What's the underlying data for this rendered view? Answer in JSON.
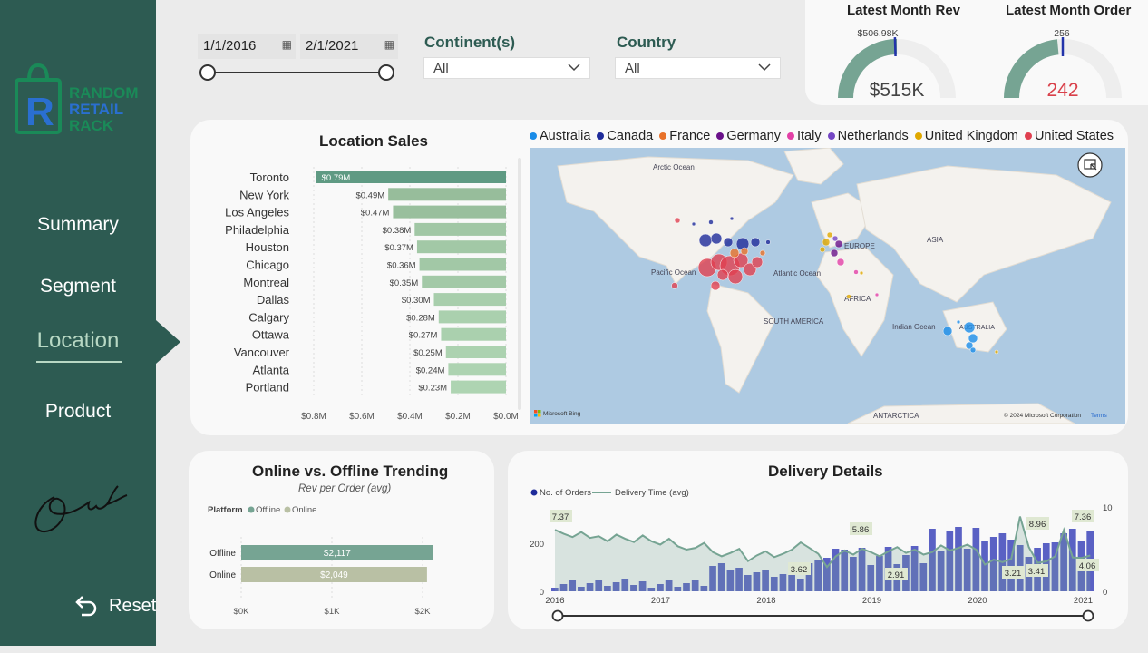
{
  "sidebar": {
    "logo_text": [
      "RANDOM",
      "RETAIL",
      "RACK"
    ],
    "nav": [
      {
        "label": "Summary"
      },
      {
        "label": "Segment"
      },
      {
        "label": "Location"
      },
      {
        "label": "Product"
      }
    ],
    "active": "Location",
    "reset_label": "Reset"
  },
  "filters": {
    "start_date": "1/1/2016",
    "end_date": "2/1/2021",
    "date_range_fraction": {
      "start": 0.0,
      "end": 1.0
    },
    "continent_label": "Continent(s)",
    "continent_value": "All",
    "country_label": "Country",
    "country_value": "All"
  },
  "kpi": {
    "rev": {
      "title": "Latest Month Rev",
      "value": "$515K",
      "target": "$506.98K",
      "gauge_fraction": 0.5,
      "target_fraction": 0.49
    },
    "order": {
      "title": "Latest Month Order",
      "value": "242",
      "target": "256",
      "gauge_fraction": 0.47,
      "target_fraction": 0.5
    }
  },
  "location_sales": {
    "title": "Location Sales",
    "cities": [
      "Toronto",
      "New York",
      "Los Angeles",
      "Philadelphia",
      "Houston",
      "Chicago",
      "Montreal",
      "Dallas",
      "Calgary",
      "Ottawa",
      "Vancouver",
      "Atlanta",
      "Portland"
    ],
    "value_labels": [
      "$0.79M",
      "$0.49M",
      "$0.47M",
      "$0.38M",
      "$0.37M",
      "$0.36M",
      "$0.35M",
      "$0.30M",
      "$0.28M",
      "$0.27M",
      "$0.25M",
      "$0.24M",
      "$0.23M"
    ],
    "values": [
      0.79,
      0.49,
      0.47,
      0.38,
      0.37,
      0.36,
      0.35,
      0.3,
      0.28,
      0.27,
      0.25,
      0.24,
      0.23
    ],
    "axis_ticks": [
      "$0.8M",
      "$0.6M",
      "$0.4M",
      "$0.2M",
      "$0.0M"
    ]
  },
  "map": {
    "legend": [
      {
        "name": "Australia",
        "color": "#1a8ce8"
      },
      {
        "name": "Canada",
        "color": "#1e2b9a"
      },
      {
        "name": "France",
        "color": "#e8722a"
      },
      {
        "name": "Germany",
        "color": "#6a118a"
      },
      {
        "name": "Italy",
        "color": "#e240a6"
      },
      {
        "name": "Netherlands",
        "color": "#7446c4"
      },
      {
        "name": "United Kingdom",
        "color": "#e0a800"
      },
      {
        "name": "United States",
        "color": "#e04050"
      }
    ],
    "labels": {
      "arctic": "Arctic Ocean",
      "pacific": "Pacific Ocean",
      "atlantic": "Atlantic Ocean",
      "indian": "Indian Ocean",
      "europe": "EUROPE",
      "asia": "ASIA",
      "africa": "AFRICA",
      "south_america": "SOUTH AMERICA",
      "australia": "AUSTRALIA",
      "antarctica": "ANTARCTICA"
    },
    "attribution": "© 2024 Microsoft Corporation",
    "terms": "Terms",
    "bing": "Microsoft Bing"
  },
  "online_offline": {
    "title": "Online vs. Offline Trending",
    "subtitle": "Rev per Order (avg)",
    "legend_title": "Platform",
    "legend": [
      "Offline",
      "Online"
    ],
    "colors": {
      "Offline": "#76a493",
      "Online": "#b9c0a4"
    },
    "bars": [
      {
        "label": "Offline",
        "value": 2117,
        "text": "$2,117"
      },
      {
        "label": "Online",
        "value": 2049,
        "text": "$2,049"
      }
    ],
    "axis_ticks": [
      "$0K",
      "$1K",
      "$2K"
    ]
  },
  "delivery": {
    "title": "Delivery Details",
    "legend": [
      "No. of Orders",
      "Delivery Time (avg)"
    ],
    "left_ticks": [
      "200",
      "0"
    ],
    "right_ticks": [
      "10",
      "0"
    ],
    "x_ticks": [
      "2016",
      "2017",
      "2018",
      "2019",
      "2020",
      "2021"
    ],
    "callouts": [
      "7.37",
      "5.86",
      "3.62",
      "2.91",
      "3.21",
      "8.96",
      "3.41",
      "7.36",
      "4.06"
    ],
    "colors": {
      "orders": "#5a61c4",
      "delivery": "#76a493"
    }
  },
  "chart_data": {
    "type": "bar",
    "title": "Location Sales",
    "categories": [
      "Toronto",
      "New York",
      "Los Angeles",
      "Philadelphia",
      "Houston",
      "Chicago",
      "Montreal",
      "Dallas",
      "Calgary",
      "Ottawa",
      "Vancouver",
      "Atlanta",
      "Portland"
    ],
    "values": [
      0.79,
      0.49,
      0.47,
      0.38,
      0.37,
      0.36,
      0.35,
      0.3,
      0.28,
      0.27,
      0.25,
      0.24,
      0.23
    ],
    "xlim": [
      0,
      0.8
    ]
  }
}
